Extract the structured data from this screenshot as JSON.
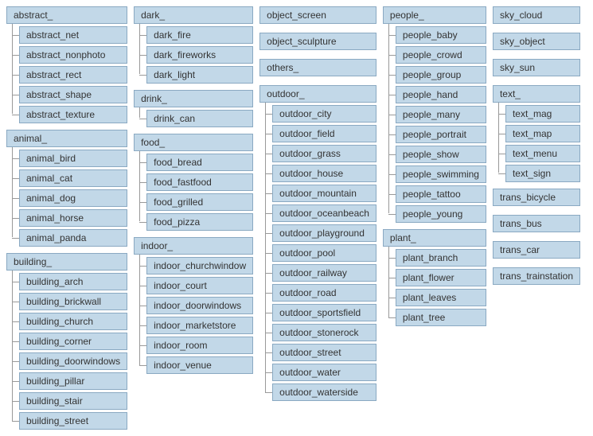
{
  "columns": [
    [
      {
        "label": "abstract_",
        "children": [
          "abstract_net",
          "abstract_nonphoto",
          "abstract_rect",
          "abstract_shape",
          "abstract_texture"
        ]
      },
      {
        "label": "animal_",
        "children": [
          "animal_bird",
          "animal_cat",
          "animal_dog",
          "animal_horse",
          "animal_panda"
        ]
      },
      {
        "label": "building_",
        "children": [
          "building_arch",
          "building_brickwall",
          "building_church",
          "building_corner",
          "building_doorwindows",
          "building_pillar",
          "building_stair",
          "building_street"
        ]
      }
    ],
    [
      {
        "label": "dark_",
        "children": [
          "dark_fire",
          "dark_fireworks",
          "dark_light"
        ]
      },
      {
        "label": "drink_",
        "children": [
          "drink_can"
        ]
      },
      {
        "label": "food_",
        "children": [
          "food_bread",
          "food_fastfood",
          "food_grilled",
          "food_pizza"
        ]
      },
      {
        "label": "indoor_",
        "children": [
          "indoor_churchwindow",
          "indoor_court",
          "indoor_doorwindows",
          "indoor_marketstore",
          "indoor_room",
          "indoor_venue"
        ]
      }
    ],
    [
      {
        "label": "object_screen"
      },
      {
        "label": "object_sculpture"
      },
      {
        "label": "others_"
      },
      {
        "label": "outdoor_",
        "children": [
          "outdoor_city",
          "outdoor_field",
          "outdoor_grass",
          "outdoor_house",
          "outdoor_mountain",
          "outdoor_oceanbeach",
          "outdoor_playground",
          "outdoor_pool",
          "outdoor_railway",
          "outdoor_road",
          "outdoor_sportsfield",
          "outdoor_stonerock",
          "outdoor_street",
          "outdoor_water",
          "outdoor_waterside"
        ]
      }
    ],
    [
      {
        "label": "people_",
        "children": [
          "people_baby",
          "people_crowd",
          "people_group",
          "people_hand",
          "people_many",
          "people_portrait",
          "people_show",
          "people_swimming",
          "people_tattoo",
          "people_young"
        ]
      },
      {
        "label": "plant_",
        "children": [
          "plant_branch",
          "plant_flower",
          "plant_leaves",
          "plant_tree"
        ]
      }
    ],
    [
      {
        "label": "sky_cloud"
      },
      {
        "label": "sky_object"
      },
      {
        "label": "sky_sun"
      },
      {
        "label": "text_",
        "children": [
          "text_mag",
          "text_map",
          "text_menu",
          "text_sign"
        ]
      },
      {
        "label": "trans_bicycle"
      },
      {
        "label": "trans_bus"
      },
      {
        "label": "trans_car"
      },
      {
        "label": "trans_trainstation"
      }
    ]
  ]
}
